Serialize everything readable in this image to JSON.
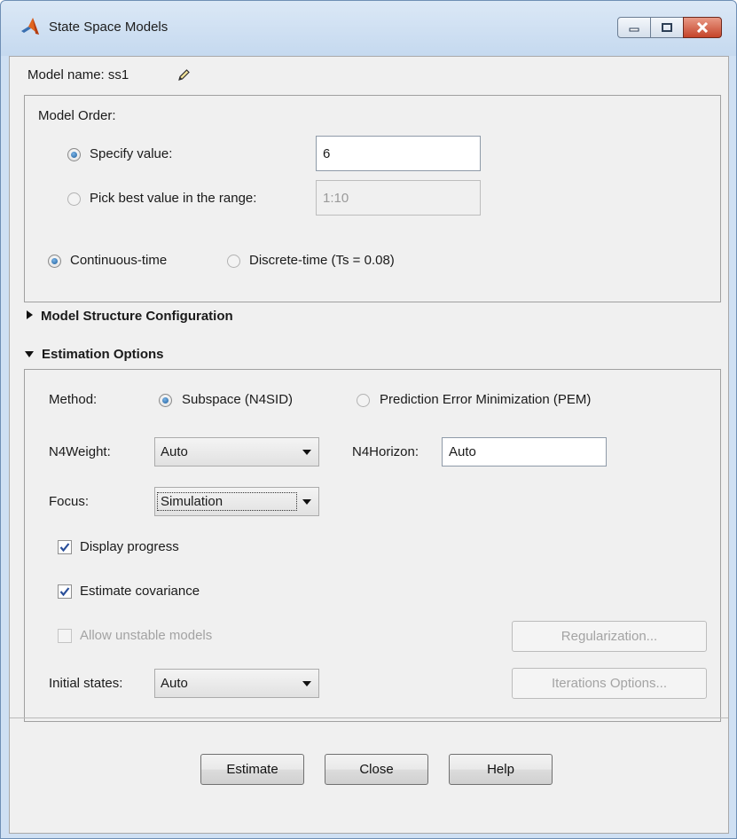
{
  "window": {
    "title": "State Space Models",
    "icon": "matlab-icon",
    "controls": [
      "minimize-icon",
      "maximize-icon",
      "close-icon"
    ]
  },
  "model_name": {
    "label": "Model name: ss1",
    "edit_icon": "pencil-icon"
  },
  "model_order": {
    "title": "Model Order:",
    "specify_label": "Specify value:",
    "specify_selected": true,
    "specify_value": "6",
    "range_label": "Pick best value in the range:",
    "range_selected": false,
    "range_value": "1:10"
  },
  "time_domain": {
    "continuous_label": "Continuous-time",
    "continuous_selected": true,
    "discrete_label": "Discrete-time (Ts = 0.08)",
    "discrete_selected": false
  },
  "structure_section": {
    "label": "Model Structure Configuration",
    "expanded": false
  },
  "estimation_section": {
    "label": "Estimation Options",
    "expanded": true,
    "method_label": "Method:",
    "method_subspace": "Subspace (N4SID)",
    "method_subspace_selected": true,
    "method_pem": "Prediction Error Minimization (PEM)",
    "method_pem_selected": false,
    "n4weight_label": "N4Weight:",
    "n4weight_value": "Auto",
    "n4horizon_label": "N4Horizon:",
    "n4horizon_value": "Auto",
    "focus_label": "Focus:",
    "focus_value": "Simulation",
    "display_progress_label": "Display progress",
    "display_progress_checked": true,
    "estimate_covariance_label": "Estimate covariance",
    "estimate_covariance_checked": true,
    "allow_unstable_label": "Allow unstable models",
    "allow_unstable_checked": false,
    "allow_unstable_enabled": false,
    "regularization_label": "Regularization...",
    "initial_states_label": "Initial states:",
    "initial_states_value": "Auto",
    "iterations_label": "Iterations Options..."
  },
  "footer": {
    "estimate_label": "Estimate",
    "close_label": "Close",
    "help_label": "Help"
  }
}
